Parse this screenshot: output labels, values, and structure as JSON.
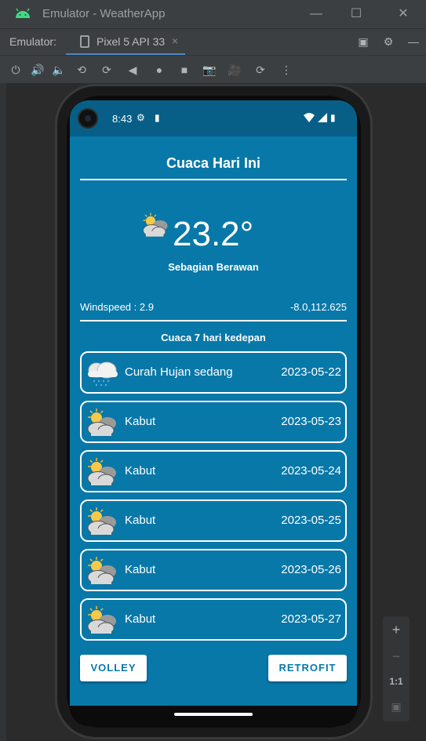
{
  "window": {
    "title": "Emulator - WeatherApp"
  },
  "toolbar": {
    "label": "Emulator:",
    "device_tab": "Pixel 5 API 33",
    "tab_close": "×"
  },
  "rail": {
    "zoom_in": "+",
    "zoom_out": "−",
    "ratio": "1:1"
  },
  "status": {
    "time": "8:43"
  },
  "app": {
    "title": "Cuaca Hari Ini",
    "current": {
      "temperature": "23.2°",
      "description": "Sebagian Berawan",
      "icon": "partly-cloudy-icon"
    },
    "windspeed": "Windspeed : 2.9",
    "coordinates": "-8.0,112.625",
    "forecast_heading": "Cuaca 7 hari kedepan",
    "forecast": [
      {
        "desc": "Curah Hujan sedang",
        "date": "2023-05-22",
        "icon": "rain-cloud-icon"
      },
      {
        "desc": "Kabut",
        "date": "2023-05-23",
        "icon": "partly-cloudy-icon"
      },
      {
        "desc": "Kabut",
        "date": "2023-05-24",
        "icon": "partly-cloudy-icon"
      },
      {
        "desc": "Kabut",
        "date": "2023-05-25",
        "icon": "partly-cloudy-icon"
      },
      {
        "desc": "Kabut",
        "date": "2023-05-26",
        "icon": "partly-cloudy-icon"
      },
      {
        "desc": "Kabut",
        "date": "2023-05-27",
        "icon": "partly-cloudy-icon"
      }
    ],
    "buttons": {
      "volley": "VOLLEY",
      "retrofit": "RETROFIT"
    }
  },
  "colors": {
    "screen_bg": "#0878a8",
    "statusbar_bg": "#075f87",
    "ide_bg": "#3c3f41",
    "accent": "#4a88c7"
  }
}
